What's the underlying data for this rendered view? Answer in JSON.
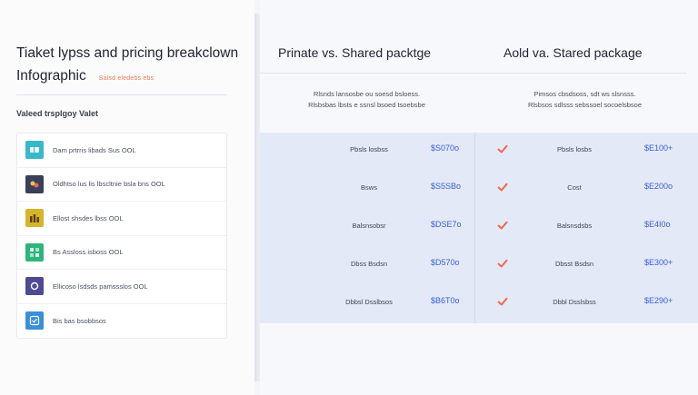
{
  "left": {
    "title_line1": "Tiaket lypss and pricing breakclown",
    "title_line2": "Infographic",
    "subtitle_tag": "Salsd eledebs ebs",
    "section_label": "Valeed trsplgoy Valet",
    "items": [
      {
        "label": "Dam prtrris libads Sus OOL",
        "color": "#3bb8c8",
        "icon": "ticket-icon"
      },
      {
        "label": "Oldhtso lus lis lbscltnie bsla bns OOL",
        "color": "#3a3f5a",
        "icon": "map-icon"
      },
      {
        "label": "Ellost shsdes lbss OOL",
        "color": "#d7b52a",
        "icon": "crowd-icon"
      },
      {
        "label": "Bs Assloss isboss OOL",
        "color": "#2fb57b",
        "icon": "grid-icon"
      },
      {
        "label": "Ellicoso lsdsds pamssslos OOL",
        "color": "#4e4a93",
        "icon": "badge-icon"
      },
      {
        "label": "Bis bas bsobbsos",
        "color": "#3a8fd6",
        "icon": "check-card-icon"
      }
    ]
  },
  "right": {
    "head_a": "Prinate vs. Shared packtge",
    "head_b": "Aold va. Stared package",
    "desc_a_line1": "Rlsnds lansosbe ou soesd bsloess.",
    "desc_a_line2": "Rlsbsbas lbsts e ssnsl bsoed tsoebsbe",
    "desc_b_line1": "Pimsos cbsdsoss, sdt ws slsnsss.",
    "desc_b_line2": "Rlsbsos sdlsss sebssoel socoelsbsoe",
    "rows": [
      {
        "name_a": "Pbsls losbss",
        "price_a": "$S070o",
        "name_b": "Pbsls losbs",
        "price_b": "$E100+"
      },
      {
        "name_a": "Bsws",
        "price_a": "$S5SBo",
        "name_b": "Cost",
        "price_b": "$E200o"
      },
      {
        "name_a": "Balsnsobsr",
        "price_a": "$DSE7o",
        "name_b": "Balsnsdsbs",
        "price_b": "$E4I0o"
      },
      {
        "name_a": "Dbss Bsdsn",
        "price_a": "$D570o",
        "name_b": "Dbsst Bsdsn",
        "price_b": "$E300+"
      },
      {
        "name_a": "Dbbsl Dsslbsos",
        "price_a": "$B6T0o",
        "name_b": "Dbbl Dsslsbss",
        "price_b": "$E290+"
      }
    ],
    "check_color": "#ef6a4c"
  }
}
